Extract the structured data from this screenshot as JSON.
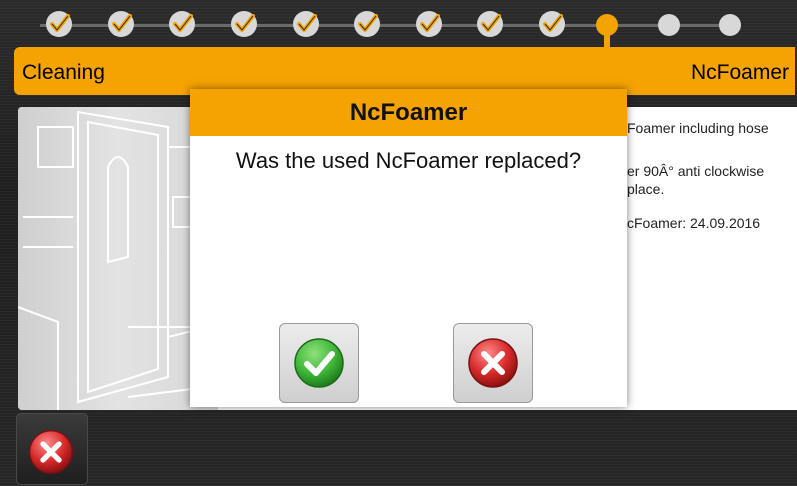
{
  "progress": {
    "completed_icon": "check-icon",
    "current_icon": "current-step-dot",
    "future_icon": "future-step-dot",
    "completed_steps": 9,
    "current_step": 10,
    "total_steps": 12
  },
  "header": {
    "title": "Cleaning",
    "right_label": "NcFoamer"
  },
  "content": {
    "instruction_lines": [
      "Foamer including hose",
      "er 90Â° anti clockwise",
      "place.",
      "cFoamer: 24.09.2016"
    ]
  },
  "modal": {
    "title": "NcFoamer",
    "question": "Was the used NcFoamer replaced?",
    "confirm_icon": "green-check-icon",
    "cancel_icon": "red-x-icon"
  },
  "footer": {
    "close_icon": "red-x-icon"
  },
  "colors": {
    "accent": "#f5a300",
    "confirm": "#3fb83a",
    "cancel": "#d82a2a",
    "background": "#242424"
  }
}
